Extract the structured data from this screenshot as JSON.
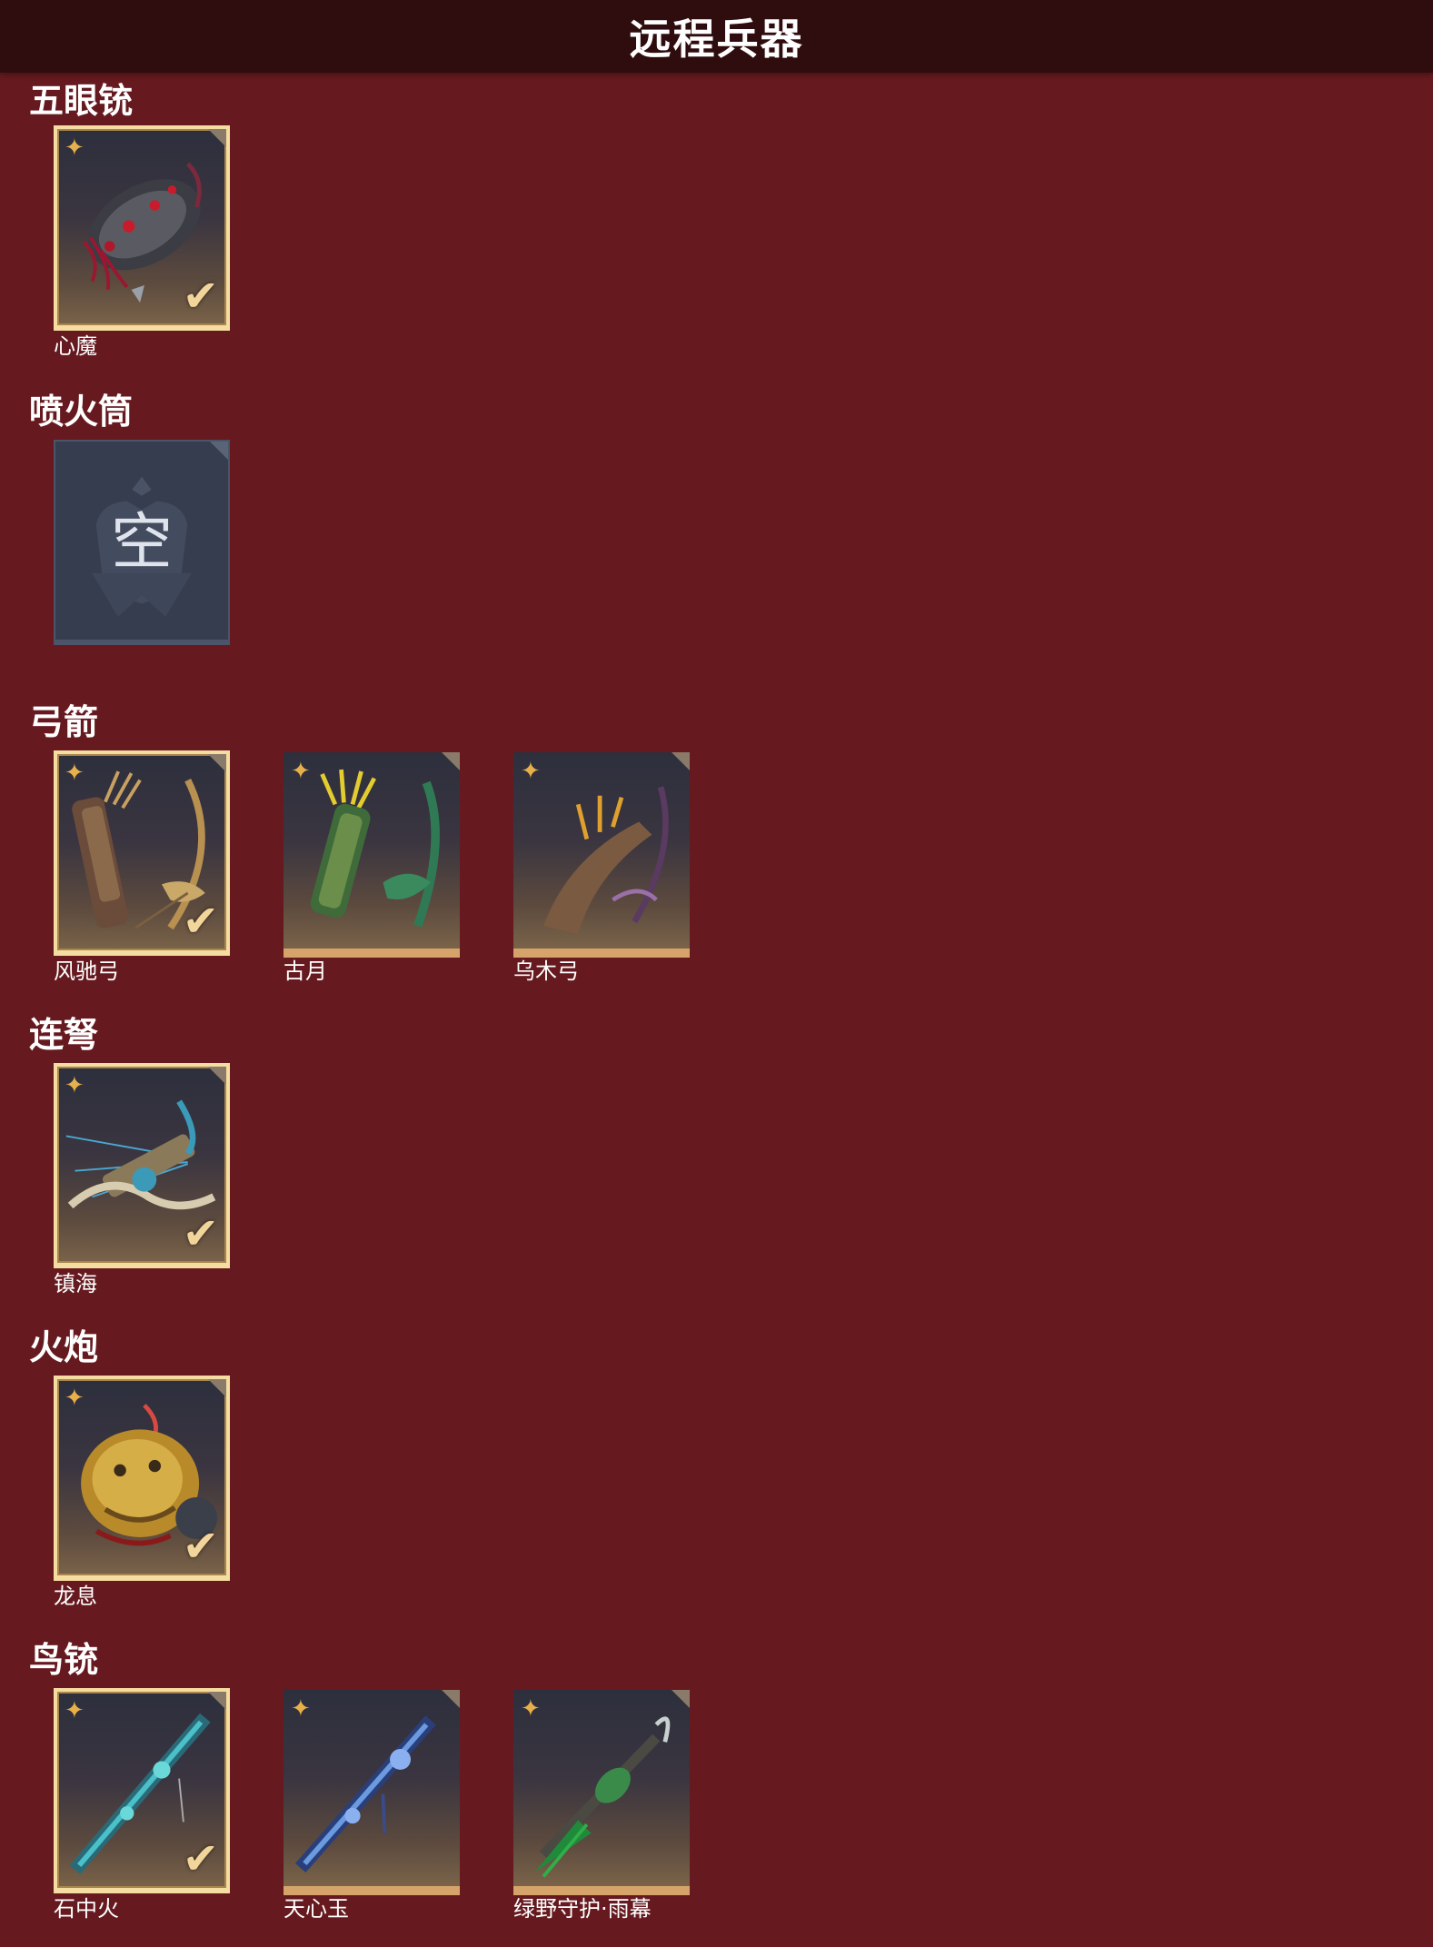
{
  "header": {
    "title": "远程兵器"
  },
  "sections": [
    {
      "title": "五眼铳",
      "items": [
        {
          "name": "心魔",
          "selected": true
        }
      ]
    },
    {
      "title": "喷火筒",
      "empty_label": "空"
    },
    {
      "title": "弓箭",
      "items": [
        {
          "name": "风驰弓",
          "selected": true
        },
        {
          "name": "古月",
          "selected": false
        },
        {
          "name": "乌木弓",
          "selected": false
        }
      ]
    },
    {
      "title": "连弩",
      "items": [
        {
          "name": "镇海",
          "selected": true
        }
      ]
    },
    {
      "title": "火炮",
      "items": [
        {
          "name": "龙息",
          "selected": true
        }
      ]
    },
    {
      "title": "鸟铳",
      "items": [
        {
          "name": "石中火",
          "selected": true
        },
        {
          "name": "天心玉",
          "selected": false
        },
        {
          "name": "绿野守护·雨幕",
          "selected": false
        }
      ]
    }
  ],
  "icons": {
    "rarity": "four-point-star-icon",
    "equipped": "checkmark-icon",
    "corner": "corner-tag-icon"
  },
  "colors": {
    "background": "#661a1f",
    "titlebar": "#2f0c0e",
    "selected_border": "#f5dca0",
    "rarity_star": "#e8b04a",
    "card_bottom": "#d6a46a",
    "empty_card": "#363d4e"
  }
}
